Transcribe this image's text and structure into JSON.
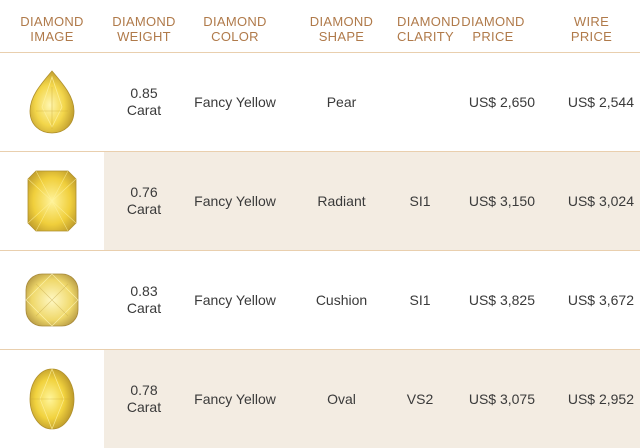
{
  "headers": [
    {
      "line1": "DIAMOND",
      "line2": "IMAGE"
    },
    {
      "line1": "DIAMOND",
      "line2": "WEIGHT"
    },
    {
      "line1": "DIAMOND",
      "line2": "COLOR"
    },
    {
      "line1": "DIAMOND",
      "line2": "SHAPE"
    },
    {
      "line1": "DIAMOND",
      "line2": "CLARITY"
    },
    {
      "line1": "DIAMOND",
      "line2": "PRICE"
    },
    {
      "line1": "WIRE",
      "line2": "PRICE"
    }
  ],
  "rows": [
    {
      "image": "pear-diamond-icon",
      "weight": "0.85",
      "unit": "Carat",
      "color": "Fancy Yellow",
      "shape": "Pear",
      "clarity": "",
      "diamond_price": "US$ 2,650",
      "wire_price": "US$ 2,544"
    },
    {
      "image": "radiant-diamond-icon",
      "weight": "0.76",
      "unit": "Carat",
      "color": "Fancy Yellow",
      "shape": "Radiant",
      "clarity": "SI1",
      "diamond_price": "US$ 3,150",
      "wire_price": "US$ 3,024"
    },
    {
      "image": "cushion-diamond-icon",
      "weight": "0.83",
      "unit": "Carat",
      "color": "Fancy Yellow",
      "shape": "Cushion",
      "clarity": "SI1",
      "diamond_price": "US$ 3,825",
      "wire_price": "US$ 3,672"
    },
    {
      "image": "oval-diamond-icon",
      "weight": "0.78",
      "unit": "Carat",
      "color": "Fancy Yellow",
      "shape": "Oval",
      "clarity": "VS2",
      "diamond_price": "US$ 3,075",
      "wire_price": "US$ 2,952"
    }
  ],
  "colors": {
    "header_text": "#b07a4a",
    "row_alt_bg": "#f3ece2",
    "divider": "#e9cfae",
    "diamond_yellow": "#f3d64a"
  }
}
